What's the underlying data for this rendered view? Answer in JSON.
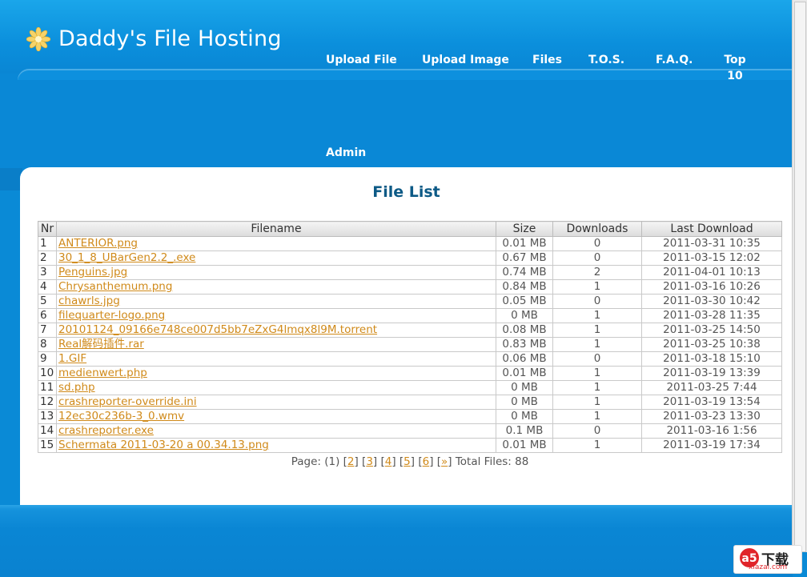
{
  "site": {
    "title": "Daddy's File Hosting"
  },
  "nav": {
    "items": [
      {
        "label": "Upload File"
      },
      {
        "label": "Upload Image"
      },
      {
        "label": "Files"
      },
      {
        "label": "T.O.S."
      },
      {
        "label": "F.A.Q."
      },
      {
        "label": "Top 10"
      },
      {
        "label": "Admin"
      }
    ]
  },
  "main": {
    "title": "File List",
    "table": {
      "headers": [
        "Nr",
        "Filename",
        "Size",
        "Downloads",
        "Last Download"
      ],
      "rows": [
        [
          "1",
          "ANTERIOR.png",
          "0.01 MB",
          "0",
          "2011-03-31 10:35"
        ],
        [
          "2",
          "30_1_8_UBarGen2.2_.exe",
          "0.67 MB",
          "0",
          "2011-03-15 12:02"
        ],
        [
          "3",
          "Penguins.jpg",
          "0.74 MB",
          "2",
          "2011-04-01 10:13"
        ],
        [
          "4",
          "Chrysanthemum.png",
          "0.84 MB",
          "1",
          "2011-03-16 10:26"
        ],
        [
          "5",
          "chawrls.jpg",
          "0.05 MB",
          "0",
          "2011-03-30 10:42"
        ],
        [
          "6",
          "filequarter-logo.png",
          "0 MB",
          "1",
          "2011-03-28 11:35"
        ],
        [
          "7",
          "20101124_09166e748ce007d5bb7eZxG4lmqx8l9M.torrent",
          "0.08 MB",
          "1",
          "2011-03-25 14:50"
        ],
        [
          "8",
          "Real解码插件.rar",
          "0.83 MB",
          "1",
          "2011-03-25 10:38"
        ],
        [
          "9",
          "1.GIF",
          "0.06 MB",
          "0",
          "2011-03-18 15:10"
        ],
        [
          "10",
          "medienwert.php",
          "0.01 MB",
          "1",
          "2011-03-19 13:39"
        ],
        [
          "11",
          "sd.php",
          "0 MB",
          "1",
          "2011-03-25 7:44"
        ],
        [
          "12",
          "crashreporter-override.ini",
          "0 MB",
          "1",
          "2011-03-19 13:54"
        ],
        [
          "13",
          "12ec30c236b-3_0.wmv",
          "0 MB",
          "1",
          "2011-03-23 13:30"
        ],
        [
          "14",
          "crashreporter.exe",
          "0.1 MB",
          "0",
          "2011-03-16 1:56"
        ],
        [
          "15",
          "Schermata 2011-03-20 a 00.34.13.png",
          "0.01 MB",
          "1",
          "2011-03-19 17:34"
        ]
      ]
    },
    "pager": {
      "prefix": "Page: (1)",
      "pages": [
        "2",
        "3",
        "4",
        "5",
        "6",
        "»"
      ],
      "total": "Total Files: 88"
    }
  },
  "watermark": {
    "brand": "下载",
    "url": "xiazai.com"
  },
  "colors": {
    "header_blue": "#0a8ad6",
    "link_orange": "#d08a1a",
    "title_blue": "#0d5a86"
  }
}
